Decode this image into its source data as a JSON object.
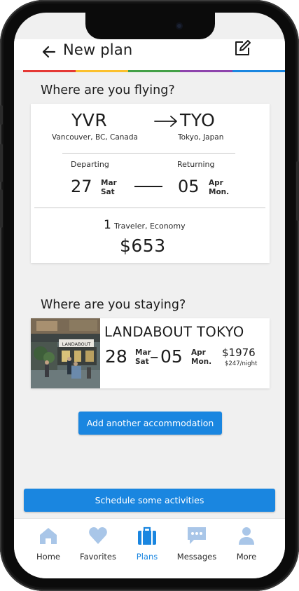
{
  "header": {
    "title": "New plan",
    "back_icon": "arrow-left-icon",
    "edit_icon": "edit-icon"
  },
  "rainbow_colors": [
    "#e53935",
    "#fbc02d",
    "#43a047",
    "#8e44ad",
    "#1a86e0"
  ],
  "flight": {
    "section_title": "Where are you flying?",
    "origin": {
      "code": "YVR",
      "city": "Vancouver, BC, Canada"
    },
    "destination": {
      "code": "TYO",
      "city": "Tokyo, Japan"
    },
    "departing": {
      "label": "Departing",
      "day": "27",
      "month": "Mar",
      "weekday": "Sat"
    },
    "returning": {
      "label": "Returning",
      "day": "05",
      "month": "Apr",
      "weekday": "Mon."
    },
    "traveler_count": "1",
    "traveler_desc": "Traveler, Economy",
    "price": "$653"
  },
  "stay": {
    "section_title": "Where are you staying?",
    "hotel_name": "LANDABOUT TOKYO",
    "hotel_sign": "LANDABOUT",
    "check_in": {
      "day": "28",
      "month": "Mar",
      "weekday": "Sat"
    },
    "check_out": {
      "day": "05",
      "month": "Apr",
      "weekday": "Mon."
    },
    "separator": "–",
    "total": "$1976",
    "per_night": "$247/night"
  },
  "buttons": {
    "add_accommodation": "Add another accommodation",
    "schedule_activities": "Schedule some activities"
  },
  "tabs": [
    {
      "label": "Home",
      "icon": "home-icon",
      "active": false
    },
    {
      "label": "Favorites",
      "icon": "heart-icon",
      "active": false
    },
    {
      "label": "Plans",
      "icon": "suitcase-icon",
      "active": true
    },
    {
      "label": "Messages",
      "icon": "chat-icon",
      "active": false
    },
    {
      "label": "More",
      "icon": "person-icon",
      "active": false
    }
  ],
  "colors": {
    "accent": "#1a86e0",
    "icon_inactive": "#a9c6e8"
  }
}
